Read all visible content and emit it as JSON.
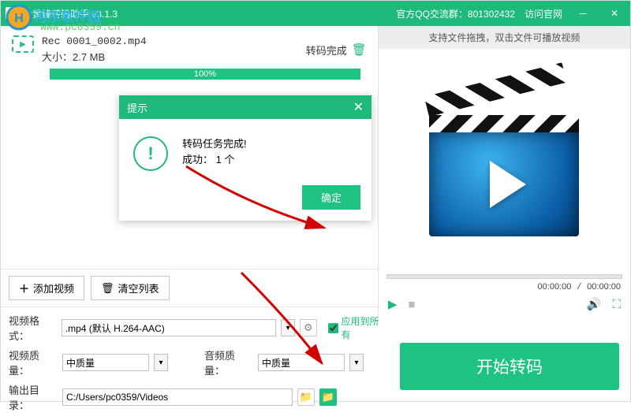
{
  "titlebar": {
    "app_title": "大黄蜂转码助手 v3.1.3",
    "qq_group": "官方QQ交流群：801302432",
    "visit_site": "访问官网"
  },
  "watermark": {
    "site_name": "河东软件园",
    "url": "www.pc0359.cn"
  },
  "file": {
    "name": "Rec 0001_0002.mp4",
    "size_label": "大小：2.7 MB",
    "status": "转码完成",
    "progress_text": "100%"
  },
  "toolbar": {
    "add_video": "添加视频",
    "clear_list": "清空列表"
  },
  "preview": {
    "hint": "支持文件拖拽，双击文件可播放视频",
    "time_cur": "00:00:00",
    "time_total": "00:00:00"
  },
  "settings": {
    "format_label": "视频格式：",
    "format_value": ".mp4 (默认 H.264-AAC)",
    "quality_label": "视频质量：",
    "quality_value": "中质量",
    "audio_quality_label": "音频质量：",
    "audio_quality_value": "中质量",
    "output_label": "输出目录：",
    "output_value": "C:/Users/pc0359/Videos",
    "apply_all": "应用到所有"
  },
  "start_button": "开始转码",
  "dialog": {
    "title": "提示",
    "line1": "转码任务完成!",
    "line2": "成功： 1 个",
    "ok": "确定"
  }
}
